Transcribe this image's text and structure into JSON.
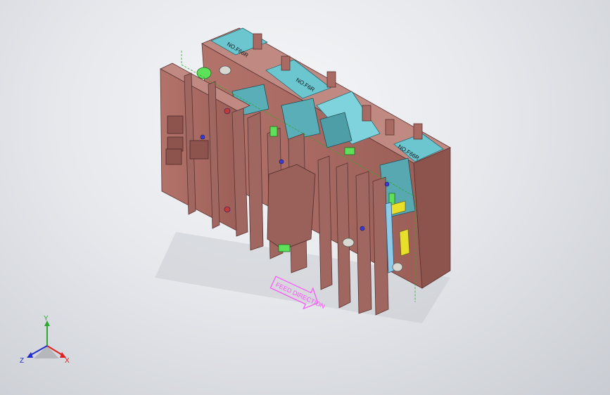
{
  "viewport": {
    "annotation": {
      "feed_direction": "FEED DIRECTION"
    },
    "plate_labels": [
      "NO.F66R",
      "NO.F6R",
      "NO.F66R"
    ],
    "triad": {
      "x_label": "X",
      "y_label": "Y",
      "z_label": "Z"
    },
    "colors": {
      "plate": "#a86a63",
      "plate_side": "#8d534d",
      "plate_top": "#c08a83",
      "insert": "#6cc6d0",
      "insert_dark": "#3f9aa6",
      "accent_green": "#5fe05a",
      "accent_yellow": "#e8df2a",
      "annotation_magenta": "#ff4fff",
      "axis_x": "#e02020",
      "axis_y": "#2ea82e",
      "axis_z": "#2030d0"
    }
  }
}
